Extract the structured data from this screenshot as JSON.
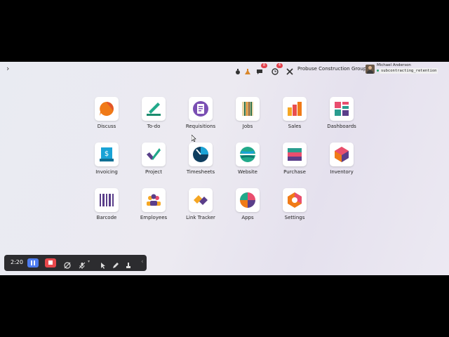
{
  "topbar": {
    "company": "Probuse Construction Group",
    "user_name": "Michael Anderson",
    "database": "subcontracting_retention",
    "messages_badge": "8",
    "activities_badge": "4"
  },
  "apps": [
    {
      "label": "Discuss"
    },
    {
      "label": "To-do"
    },
    {
      "label": "Requisitions"
    },
    {
      "label": "Jobs"
    },
    {
      "label": "Sales"
    },
    {
      "label": "Dashboards"
    },
    {
      "label": "Invoicing"
    },
    {
      "label": "Project"
    },
    {
      "label": "Timesheets"
    },
    {
      "label": "Website"
    },
    {
      "label": "Purchase"
    },
    {
      "label": "Inventory"
    },
    {
      "label": "Barcode"
    },
    {
      "label": "Employees"
    },
    {
      "label": "Link Tracker"
    },
    {
      "label": "Apps"
    },
    {
      "label": "Settings"
    }
  ],
  "recorder": {
    "time": "2:20",
    "colors": {
      "pause": "#4d7cf0",
      "stop": "#e8484c"
    }
  }
}
